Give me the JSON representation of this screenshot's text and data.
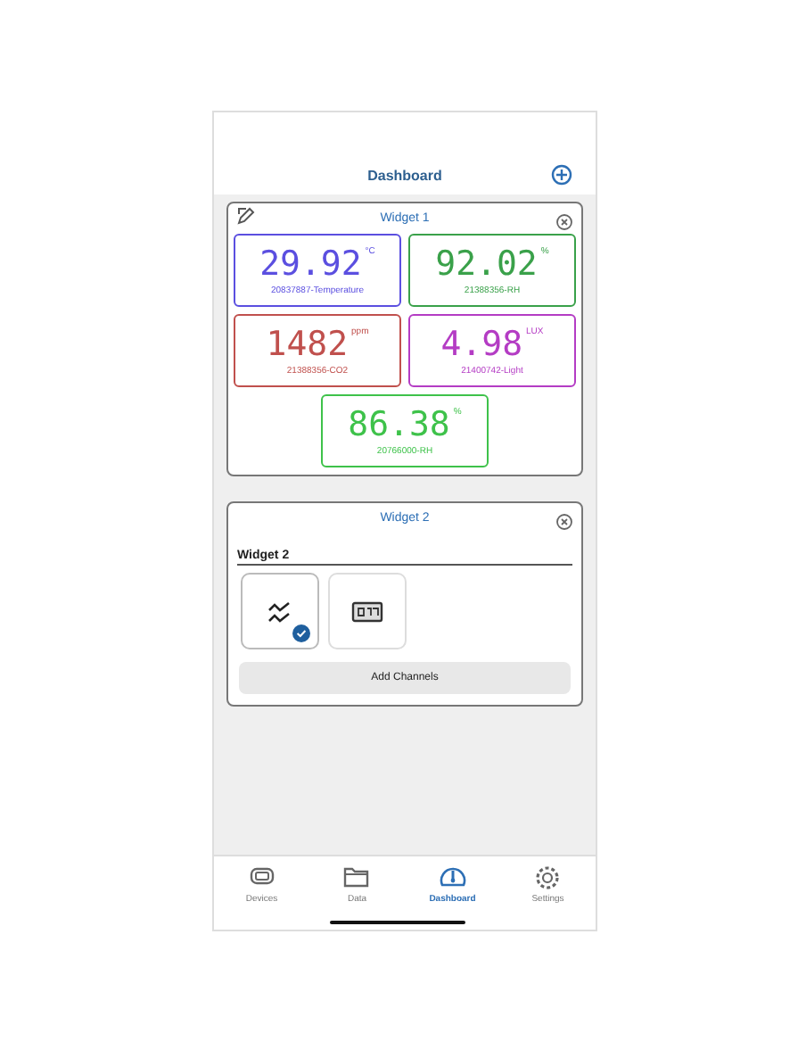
{
  "header": {
    "title": "Dashboard"
  },
  "widgets": [
    {
      "title": "Widget 1",
      "kind": "readings",
      "tiles": [
        {
          "value": "29.92",
          "unit": "°C",
          "label": "20837887-Temperature",
          "color": "#5b4fe0"
        },
        {
          "value": "92.02",
          "unit": "%",
          "label": "21388356-RH",
          "color": "#3aa14a"
        },
        {
          "value": "1482",
          "unit": "ppm",
          "label": "21388356-CO2",
          "color": "#c0504d"
        },
        {
          "value": "4.98",
          "unit": "LUX",
          "label": "21400742-Light",
          "color": "#b43cc4"
        },
        {
          "value": "86.38",
          "unit": "%",
          "label": "20766000-RH",
          "color": "#3ec24a"
        }
      ]
    },
    {
      "title": "Widget 2",
      "kind": "setup",
      "name": "Widget 2",
      "types": [
        {
          "selected": true
        },
        {
          "selected": false
        }
      ],
      "button": "Add Channels"
    }
  ],
  "tabs": [
    {
      "label": "Devices",
      "selected": false
    },
    {
      "label": "Data",
      "selected": false
    },
    {
      "label": "Dashboard",
      "selected": true
    },
    {
      "label": "Settings",
      "selected": false
    }
  ]
}
